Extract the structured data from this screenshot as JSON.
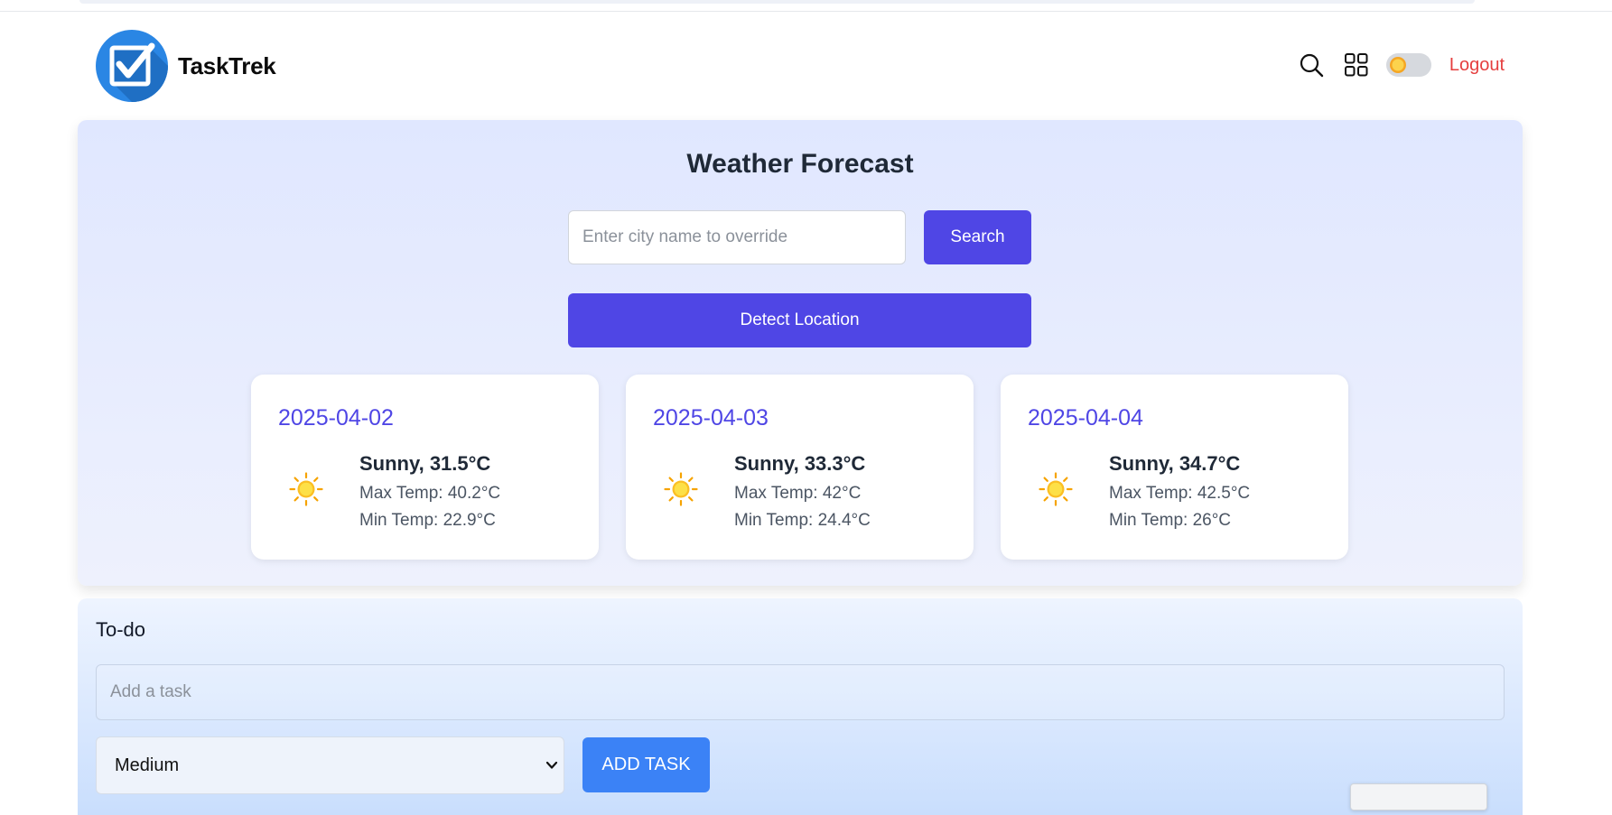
{
  "app": {
    "brand": "TaskTrek"
  },
  "header": {
    "icons": [
      "search-icon",
      "grid-icon",
      "sun-icon"
    ],
    "theme_toggle_on": false,
    "logout_label": "Logout"
  },
  "weather": {
    "title": "Weather Forecast",
    "city_placeholder": "Enter city name to override",
    "city_value": "",
    "search_label": "Search",
    "detect_label": "Detect Location",
    "forecast": [
      {
        "date": "2025-04-02",
        "condition": "Sunny, 31.5°C",
        "max": "Max Temp: 40.2°C",
        "min": "Min Temp: 22.9°C",
        "icon": "sun-icon"
      },
      {
        "date": "2025-04-03",
        "condition": "Sunny, 33.3°C",
        "max": "Max Temp: 42°C",
        "min": "Min Temp: 24.4°C",
        "icon": "sun-icon"
      },
      {
        "date": "2025-04-04",
        "condition": "Sunny, 34.7°C",
        "max": "Max Temp: 42.5°C",
        "min": "Min Temp: 26°C",
        "icon": "sun-icon"
      }
    ]
  },
  "todo": {
    "title": "To-do",
    "task_placeholder": "Add a task",
    "task_value": "",
    "priority_selected": "Medium",
    "add_label": "ADD TASK"
  },
  "colors": {
    "accent": "#4f46e5",
    "add_button": "#3b82f6",
    "logout": "#e53e3e",
    "logo": "#2a86e4"
  }
}
